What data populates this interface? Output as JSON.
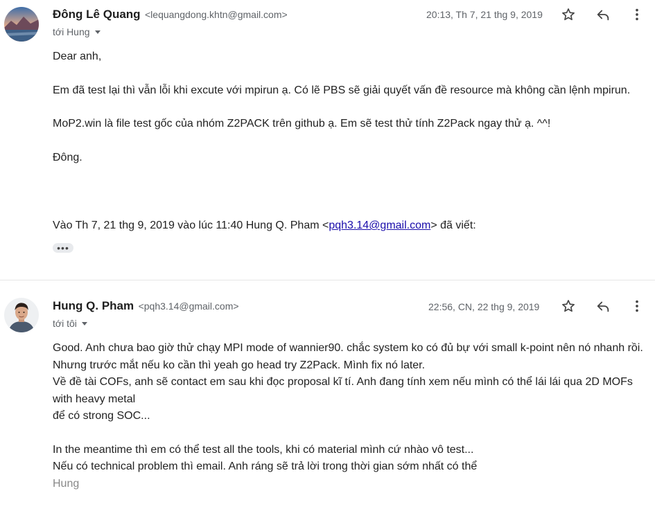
{
  "messages": [
    {
      "sender_name": "Đông Lê Quang",
      "sender_email": "<lequangdong.khtn@gmail.com>",
      "recipient": "tới Hung",
      "timestamp": "20:13, Th 7, 21 thg 9, 2019",
      "body": {
        "greeting": "Dear anh,",
        "para1": "Em đã test lại thì vẫn lỗi khi excute với mpirun ạ. Có lẽ PBS sẽ giải quyết vấn đề resource mà không cần lệnh mpirun.",
        "para2": "MoP2.win là file test gốc của nhóm Z2PACK trên github ạ. Em sẽ test thử tính Z2Pack ngay thử ạ. ^^!",
        "signoff": "Đông.",
        "quote_prefix": "Vào Th 7, 21 thg 9, 2019 vào lúc 11:40 Hung Q. Pham <",
        "quote_email": "pqh3.14@gmail.com",
        "quote_suffix": "> đã viết:"
      },
      "show_trimmed_label": "•••"
    },
    {
      "sender_name": "Hung Q. Pham",
      "sender_email": "<pqh3.14@gmail.com>",
      "recipient": "tới tôi",
      "timestamp": "22:56, CN, 22 thg 9, 2019",
      "body": {
        "line1": "Good. Anh chưa bao giờ thử chạy MPI mode of wannier90. chắc system ko có đủ bự với small k-point nên nó nhanh rồi.",
        "line2": "Nhưng trước mắt nếu ko cần thì yeah go head try Z2Pack. Mình fix nó later.",
        "line3": "Về đề tài COFs, anh sẽ contact em sau khi đọc proposal kĩ tí. Anh đang tính xem nếu mình có thể lái lái qua 2D MOFs with heavy metal",
        "line4": "để có strong SOC...",
        "line5": "In the meantime thì em có thể test all the tools, khi có material mình cứ nhào vô test...",
        "line6": "Nếu có technical problem thì email. Anh ráng sẽ trả lời trong thời gian sớm nhất có thể",
        "signature": "Hung"
      }
    }
  ],
  "icons": {
    "star": "star-icon",
    "reply": "reply-icon",
    "more": "more-vert-icon"
  },
  "colors": {
    "text": "#222222",
    "secondary": "#5f6368",
    "link": "#1a0dab",
    "divider": "#e6e6e6"
  }
}
